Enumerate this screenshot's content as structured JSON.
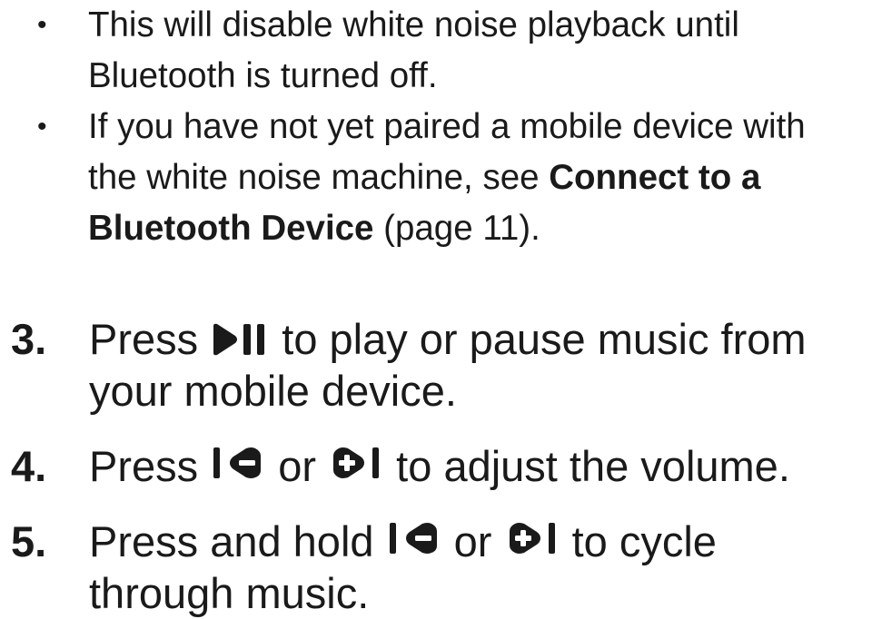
{
  "bullets": [
    {
      "text": "This will disable white noise playback until Bluetooth is turned off."
    },
    {
      "text_before": "If you have not yet paired a mobile device with the white noise machine, see ",
      "bold": "Connect to a Bluetooth Device",
      "text_after": " (page 11)."
    }
  ],
  "steps": [
    {
      "number": "3.",
      "before_icon": "Press ",
      "icon": "play-pause-icon",
      "after_icon_line1": " to play or pause music from",
      "line2": "your mobile device."
    },
    {
      "number": "4.",
      "before_icon": "Press ",
      "icon_a": "volume-down-icon",
      "between": " or ",
      "icon_b": "volume-up-icon",
      "after_icons": " to adjust the volume."
    },
    {
      "number": "5.",
      "before_icon": "Press and hold ",
      "icon_a": "previous-track-icon",
      "between": " or ",
      "icon_b": "next-track-icon",
      "after_icons_line1": " to cycle",
      "line2": "through music."
    }
  ],
  "colors": {
    "text": "#1a1a1a",
    "background": "#ffffff"
  }
}
